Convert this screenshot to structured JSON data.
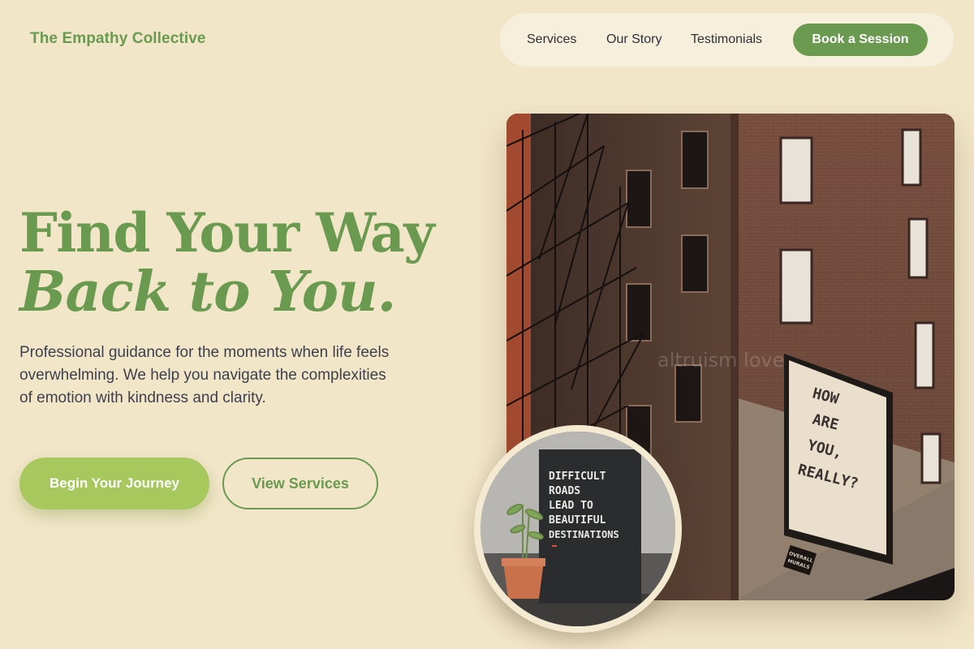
{
  "brand": {
    "name": "The Empathy Collective"
  },
  "nav": {
    "links": [
      "Services",
      "Our Story",
      "Testimonials"
    ],
    "cta": "Book a Session"
  },
  "hero": {
    "title_line1": "Find Your Way",
    "title_line2": "Back to You.",
    "description": "Professional guidance for the moments when life feels overwhelming. We help you navigate the complexities of emotion with kindness and clarity.",
    "primary_button": "Begin Your Journey",
    "secondary_button": "View Services"
  },
  "images": {
    "main": {
      "mural_lines": [
        "HOW",
        "ARE",
        "YOU,",
        "REALLY?"
      ],
      "watermark": "altruism love",
      "sign_lines": [
        "OVERALL",
        "MURALS"
      ]
    },
    "inset": {
      "board_lines": [
        "DIFFICULT",
        "ROADS",
        "LEAD TO",
        "BEAUTIFUL",
        "DESTINATIONS"
      ]
    }
  },
  "colors": {
    "background": "#f2e6c9",
    "accent": "#6a9a4f",
    "accent_light": "#a6c85c",
    "text": "#3e3f4c"
  }
}
